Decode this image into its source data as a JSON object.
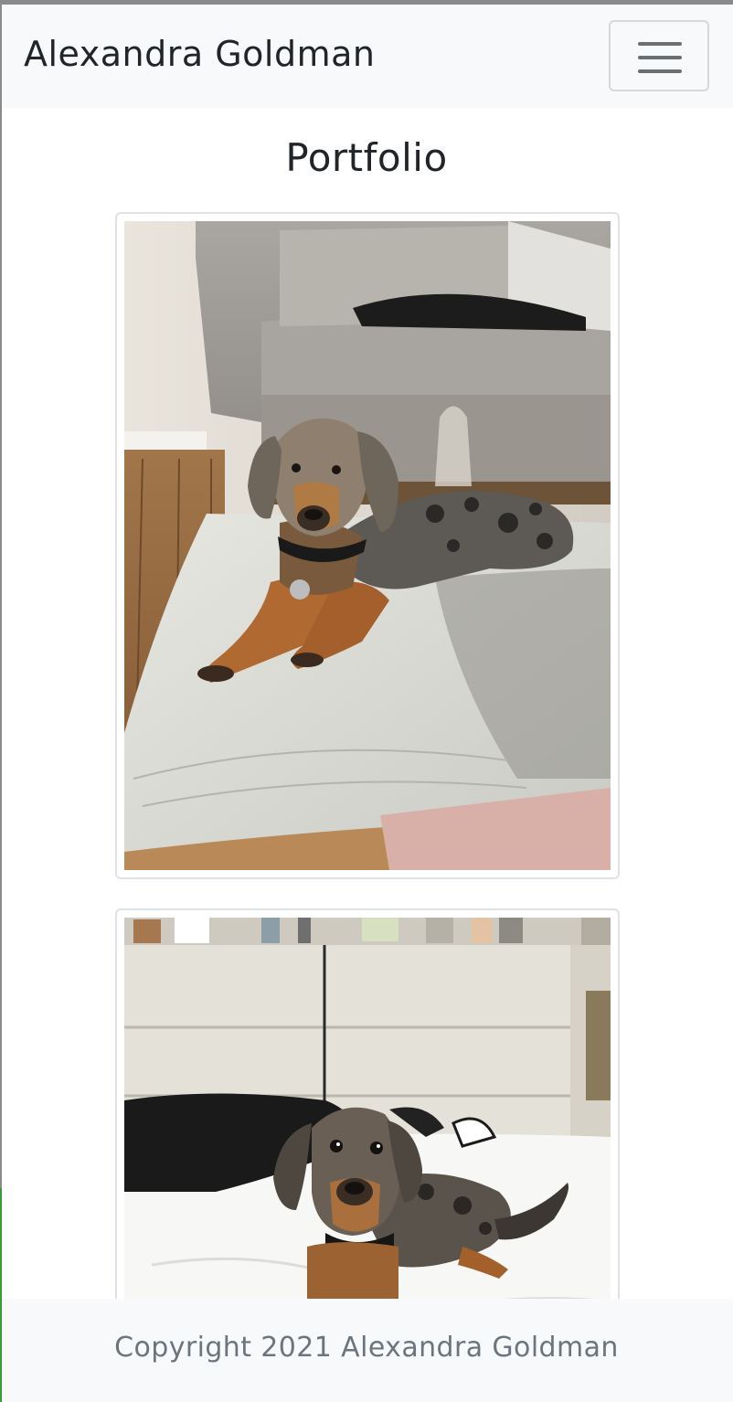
{
  "navbar": {
    "brand": "Alexandra Goldman",
    "toggle_icon": "hamburger-menu-icon"
  },
  "main": {
    "title": "Portfolio",
    "photos": [
      {
        "subject": "dog-on-cushion-photo"
      },
      {
        "subject": "dog-on-bed-photo"
      }
    ]
  },
  "footer": {
    "copyright": "Copyright 2021 Alexandra Goldman"
  },
  "colors": {
    "navbar_bg": "#f8f9fa",
    "text_dark": "#212529",
    "text_muted": "#6c757d",
    "thumb_border": "#dee2e6"
  }
}
